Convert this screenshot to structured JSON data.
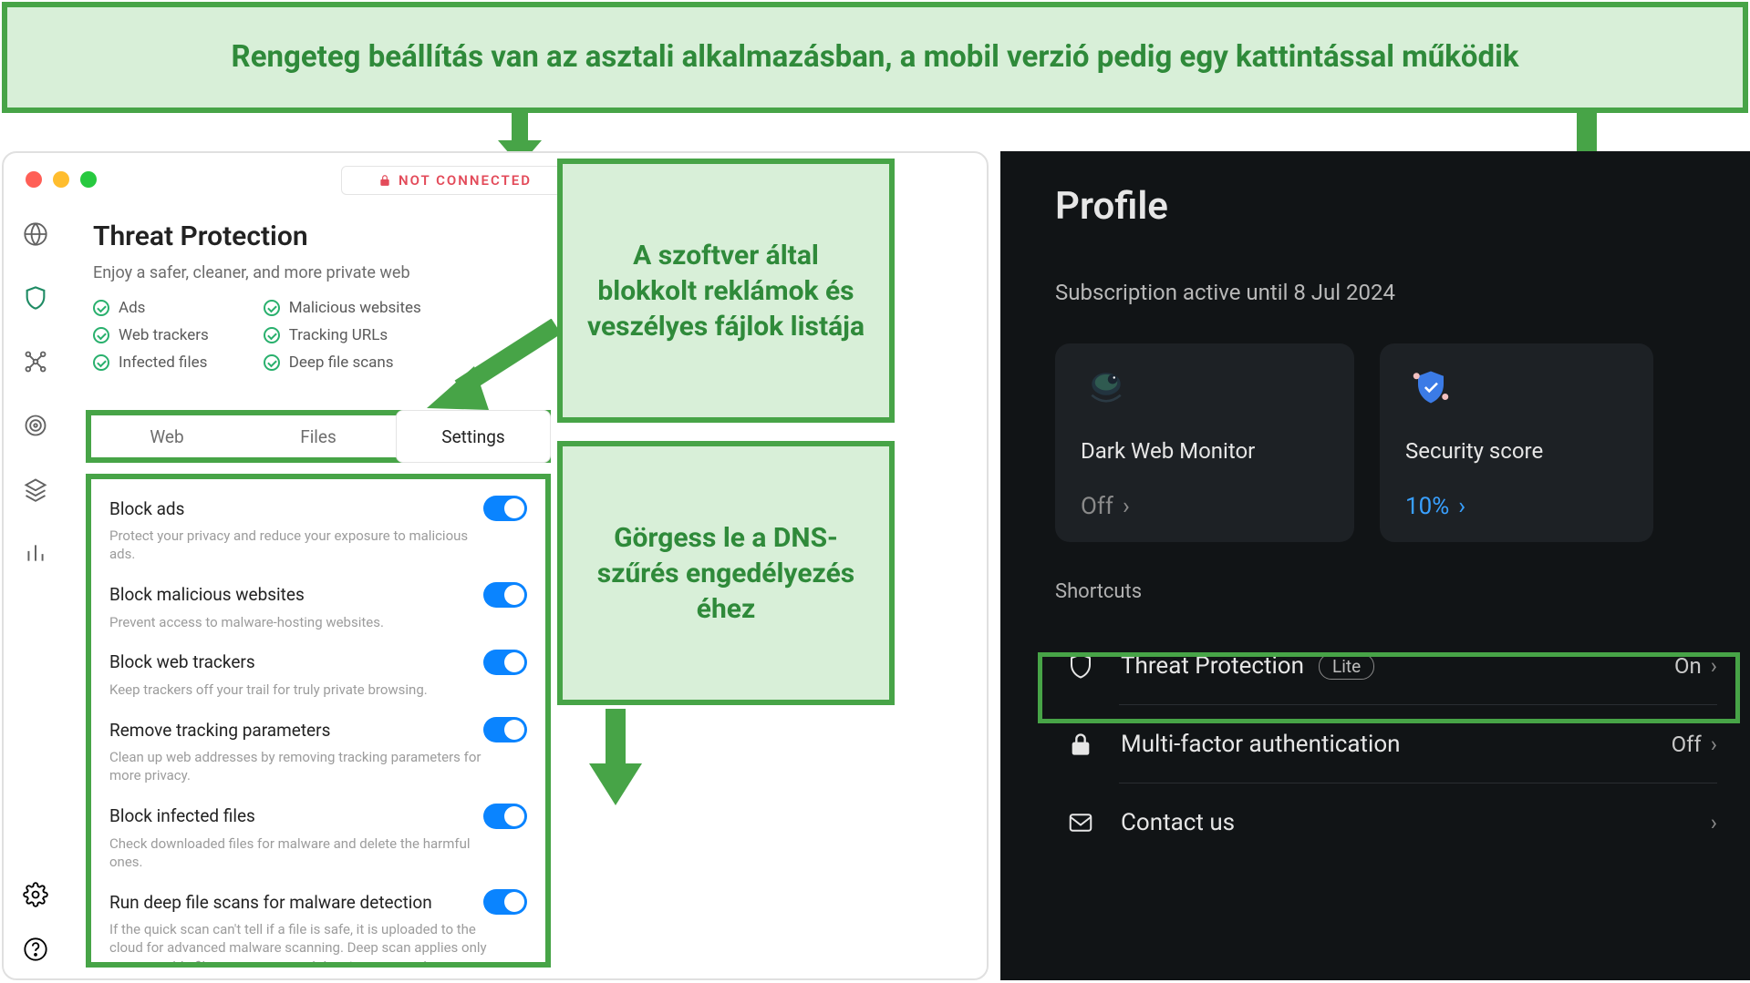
{
  "banner": {
    "text": "Rengeteg beállítás van az asztali alkalmazásban, a mobil verzió pedig egy kattintással működik"
  },
  "callouts": {
    "a": "A szoftver által blokkolt reklámok és veszélyes fájlok listája",
    "b": "Görgess le a DNS-szűrés engedélyezés éhez"
  },
  "desktop": {
    "not_connected": "NOT CONNECTED",
    "title": "Threat Protection",
    "subtitle": "Enjoy a safer, cleaner, and more private web",
    "features_left": [
      "Ads",
      "Web trackers",
      "Infected files"
    ],
    "features_right": [
      "Malicious websites",
      "Tracking URLs",
      "Deep file scans"
    ],
    "tabs": {
      "web": "Web",
      "files": "Files",
      "settings": "Settings"
    },
    "settings": [
      {
        "label": "Block ads",
        "desc": "Protect your privacy and reduce your exposure to malicious ads."
      },
      {
        "label": "Block malicious websites",
        "desc": "Prevent access to malware-hosting websites."
      },
      {
        "label": "Block web trackers",
        "desc": "Keep trackers off your trail for truly private browsing."
      },
      {
        "label": "Remove tracking parameters",
        "desc": "Clean up web addresses by removing tracking parameters for more privacy."
      },
      {
        "label": "Block infected files",
        "desc": "Check downloaded files for malware and delete the harmful ones."
      },
      {
        "label": "Run deep file scans for malware detection",
        "desc": "If the quick scan can't tell if a file is safe, it is uploaded to the cloud for advanced malware scanning. Deep scan applies only to executable files, so no personal data is processed."
      }
    ]
  },
  "mobile": {
    "title": "Profile",
    "subscription": "Subscription active until 8 Jul 2024",
    "cards": {
      "dwm": {
        "title": "Dark Web Monitor",
        "value": "Off"
      },
      "score": {
        "title": "Security score",
        "value": "10%"
      }
    },
    "section": "Shortcuts",
    "rows": {
      "tp": {
        "label": "Threat Protection",
        "badge": "Lite",
        "value": "On"
      },
      "mfa": {
        "label": "Multi-factor authentication",
        "value": "Off"
      },
      "contact": {
        "label": "Contact us"
      }
    }
  }
}
